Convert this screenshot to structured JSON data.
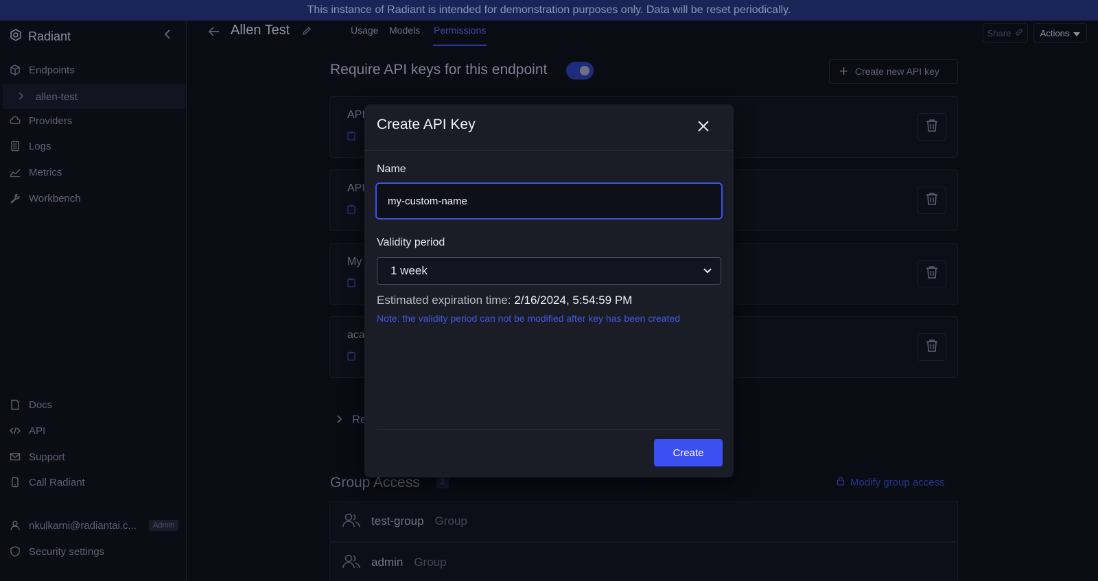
{
  "banner": {
    "text": "This instance of Radiant is intended for demonstration purposes only. Data will be reset periodically."
  },
  "sidebar": {
    "brand": "Radiant",
    "nav": [
      {
        "label": "Endpoints",
        "icon": "cube-icon"
      },
      {
        "label": "Providers",
        "icon": "cloud-icon"
      },
      {
        "label": "Logs",
        "icon": "document-icon"
      },
      {
        "label": "Metrics",
        "icon": "chart-line-icon"
      },
      {
        "label": "Workbench",
        "icon": "wrench-icon"
      }
    ],
    "endpoint_sub": "allen-test",
    "bottom_nav": [
      {
        "label": "Docs",
        "icon": "file-icon"
      },
      {
        "label": "API",
        "icon": "code-icon"
      },
      {
        "label": "Support",
        "icon": "mail-icon"
      },
      {
        "label": "Call Radiant",
        "icon": "phone-icon"
      }
    ],
    "user_email": "nkulkarni@radiantai.c...",
    "user_role": "Admin",
    "security": "Security settings"
  },
  "header": {
    "title": "Allen Test",
    "tabs": [
      "Usage",
      "Models",
      "Permissions"
    ],
    "active_tab": "Permissions",
    "share_label": "Share",
    "actions_label": "Actions"
  },
  "permissions": {
    "require_label": "Require API keys for this endpoint",
    "create_key_label": "Create new API key",
    "api_keys": [
      {
        "name": "API"
      },
      {
        "name": "API"
      },
      {
        "name": "My"
      },
      {
        "name": "aca"
      }
    ],
    "revoked_label": "Re",
    "group_access_title": "Group Access",
    "group_count": "2",
    "modify_label": "Modify group access",
    "groups": [
      {
        "name": "test-group",
        "type": "Group"
      },
      {
        "name": "admin",
        "type": "Group"
      }
    ]
  },
  "modal": {
    "title": "Create API Key",
    "name_label": "Name",
    "name_value": "my-custom-name",
    "validity_label": "Validity period",
    "validity_value": "1 week",
    "expiration_label": "Estimated expiration time:",
    "expiration_value": "2/16/2024, 5:54:59 PM",
    "note": "Note: the validity period can not be modified after key has been created",
    "create_label": "Create"
  },
  "colors": {
    "accent": "#3c50f2",
    "note": "#3f5ae6",
    "banner": "#1a2456"
  }
}
